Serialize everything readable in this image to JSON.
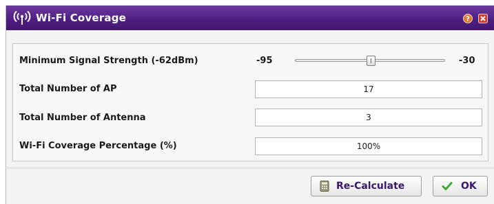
{
  "dialog": {
    "title": "Wi-Fi Coverage",
    "title_icon": "wifi-broadcast-icon",
    "help_icon": "help-icon",
    "close_icon": "close-icon",
    "accent_color": "#4f1f82"
  },
  "form": {
    "signal": {
      "label": "Minimum Signal Strength (-62dBm)",
      "min_label": "-95",
      "max_label": "-30",
      "min": -95,
      "max": -30,
      "value": -62
    },
    "total_ap": {
      "label": "Total Number of AP",
      "value": "17"
    },
    "total_antenna": {
      "label": "Total Number of Antenna",
      "value": "3"
    },
    "coverage": {
      "label": "Wi-Fi Coverage Percentage (%)",
      "value": "100%"
    }
  },
  "buttons": {
    "recalculate": {
      "label": "Re-Calculate",
      "icon": "calculator-icon"
    },
    "ok": {
      "label": "OK",
      "icon": "checkmark-icon"
    }
  }
}
